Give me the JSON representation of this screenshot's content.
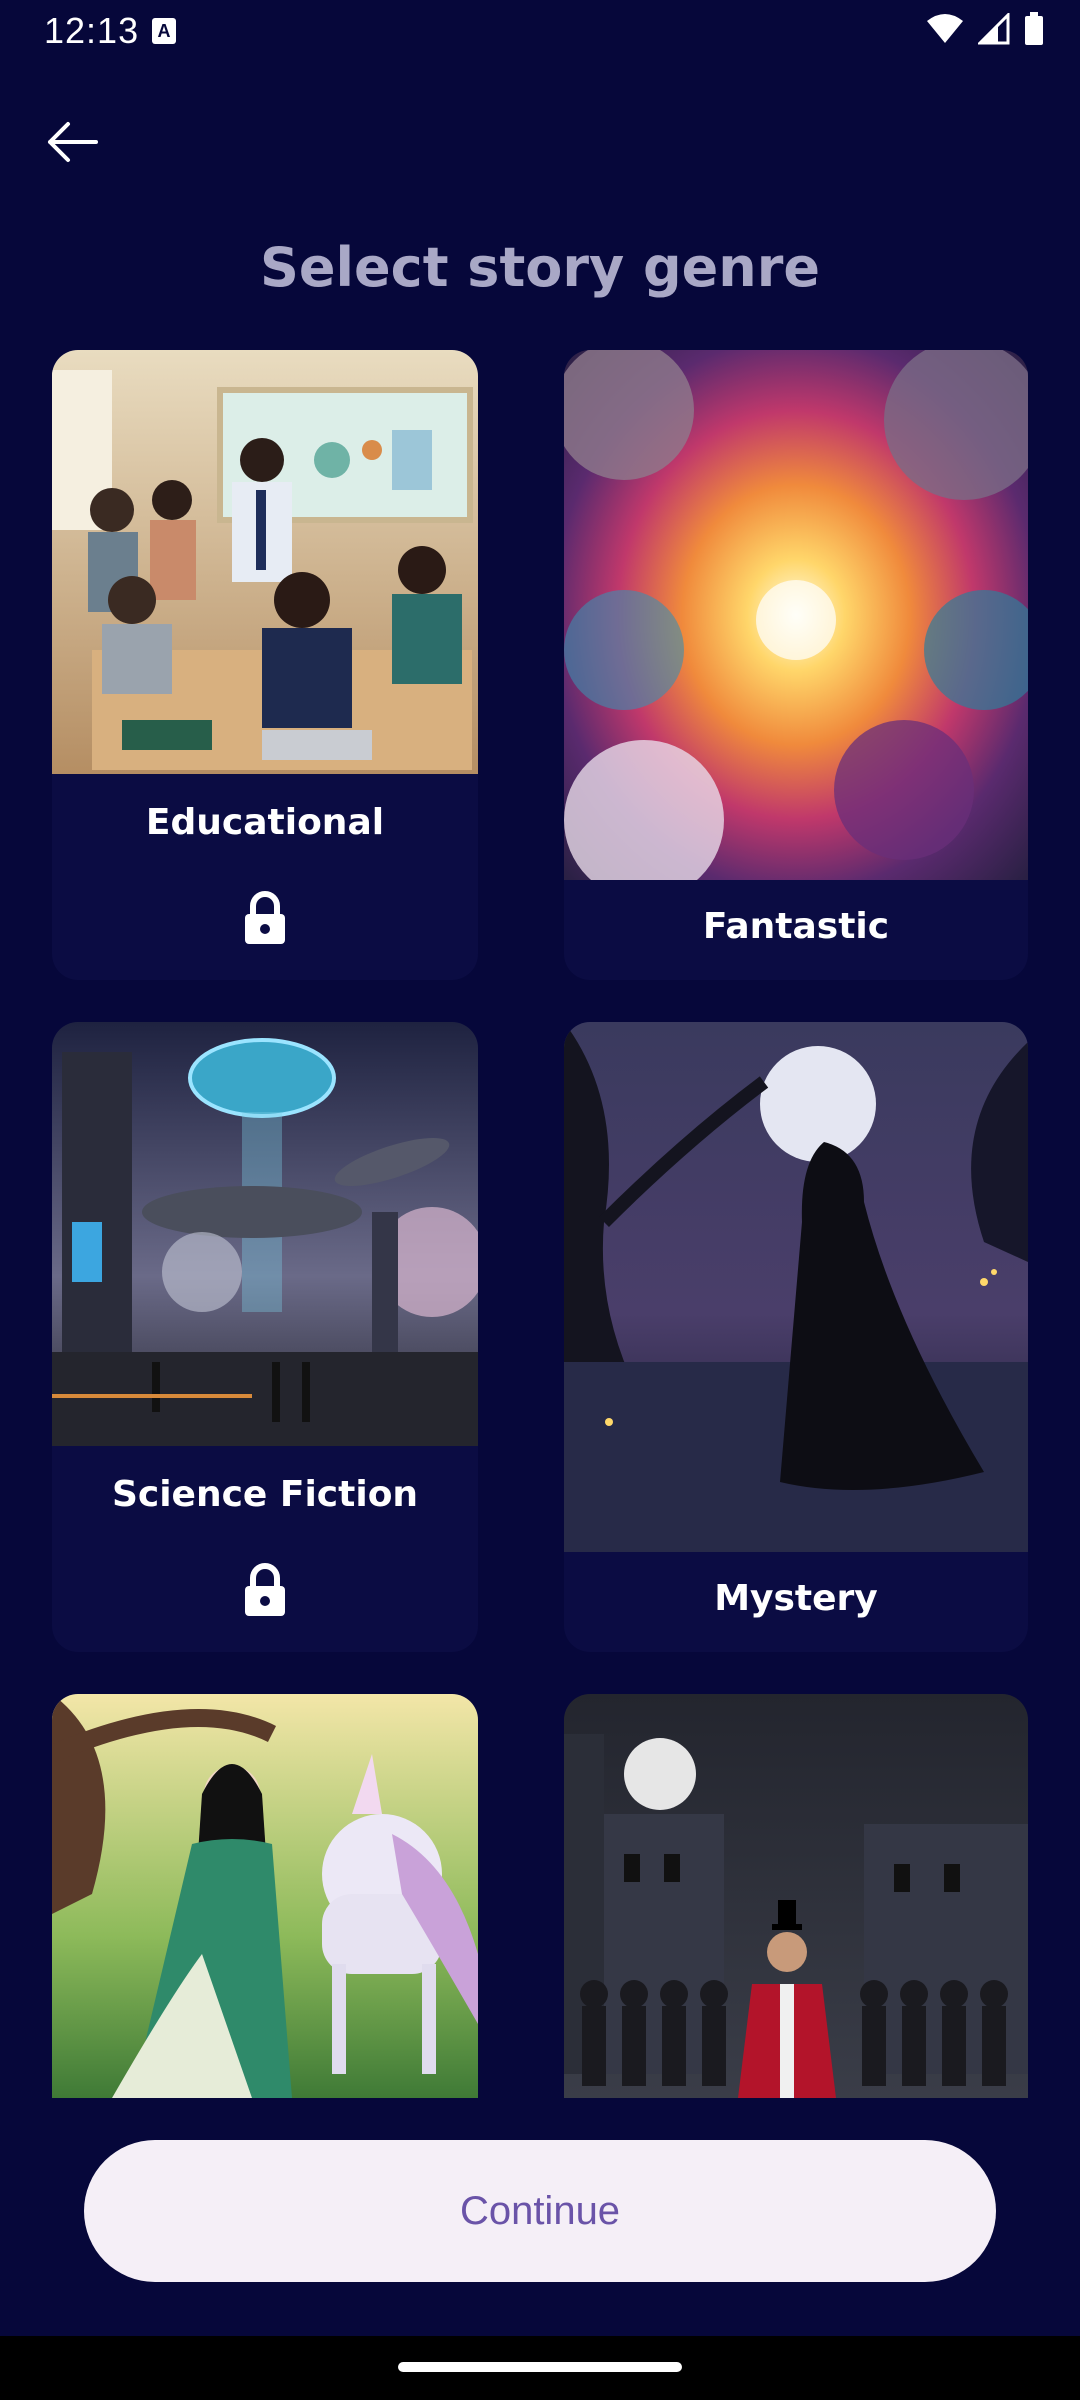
{
  "status_bar": {
    "time": "12:13",
    "notification_icon_letter": "A",
    "icons": [
      "wifi-icon",
      "signal-icon",
      "battery-icon"
    ]
  },
  "header": {
    "back_icon": "arrow-left-icon",
    "title": "Select story genre"
  },
  "genres": [
    {
      "label": "Educational",
      "locked": true,
      "image": "classroom-illustration"
    },
    {
      "label": "Fantastic",
      "locked": false,
      "image": "cosmic-clouds-illustration"
    },
    {
      "label": "Science Fiction",
      "locked": true,
      "image": "futuristic-city-illustration"
    },
    {
      "label": "Mystery",
      "locked": false,
      "image": "moonlit-cloaked-figure-illustration"
    },
    {
      "label": "",
      "locked": false,
      "image": "princess-unicorn-illustration"
    },
    {
      "label": "",
      "locked": false,
      "image": "night-street-performer-illustration"
    }
  ],
  "footer": {
    "continue_label": "Continue"
  },
  "colors": {
    "background": "#06073a",
    "card": "#0b0c43",
    "title": "#a9a8c6",
    "button_bg": "#f5eff7",
    "button_text": "#6a53a8"
  }
}
